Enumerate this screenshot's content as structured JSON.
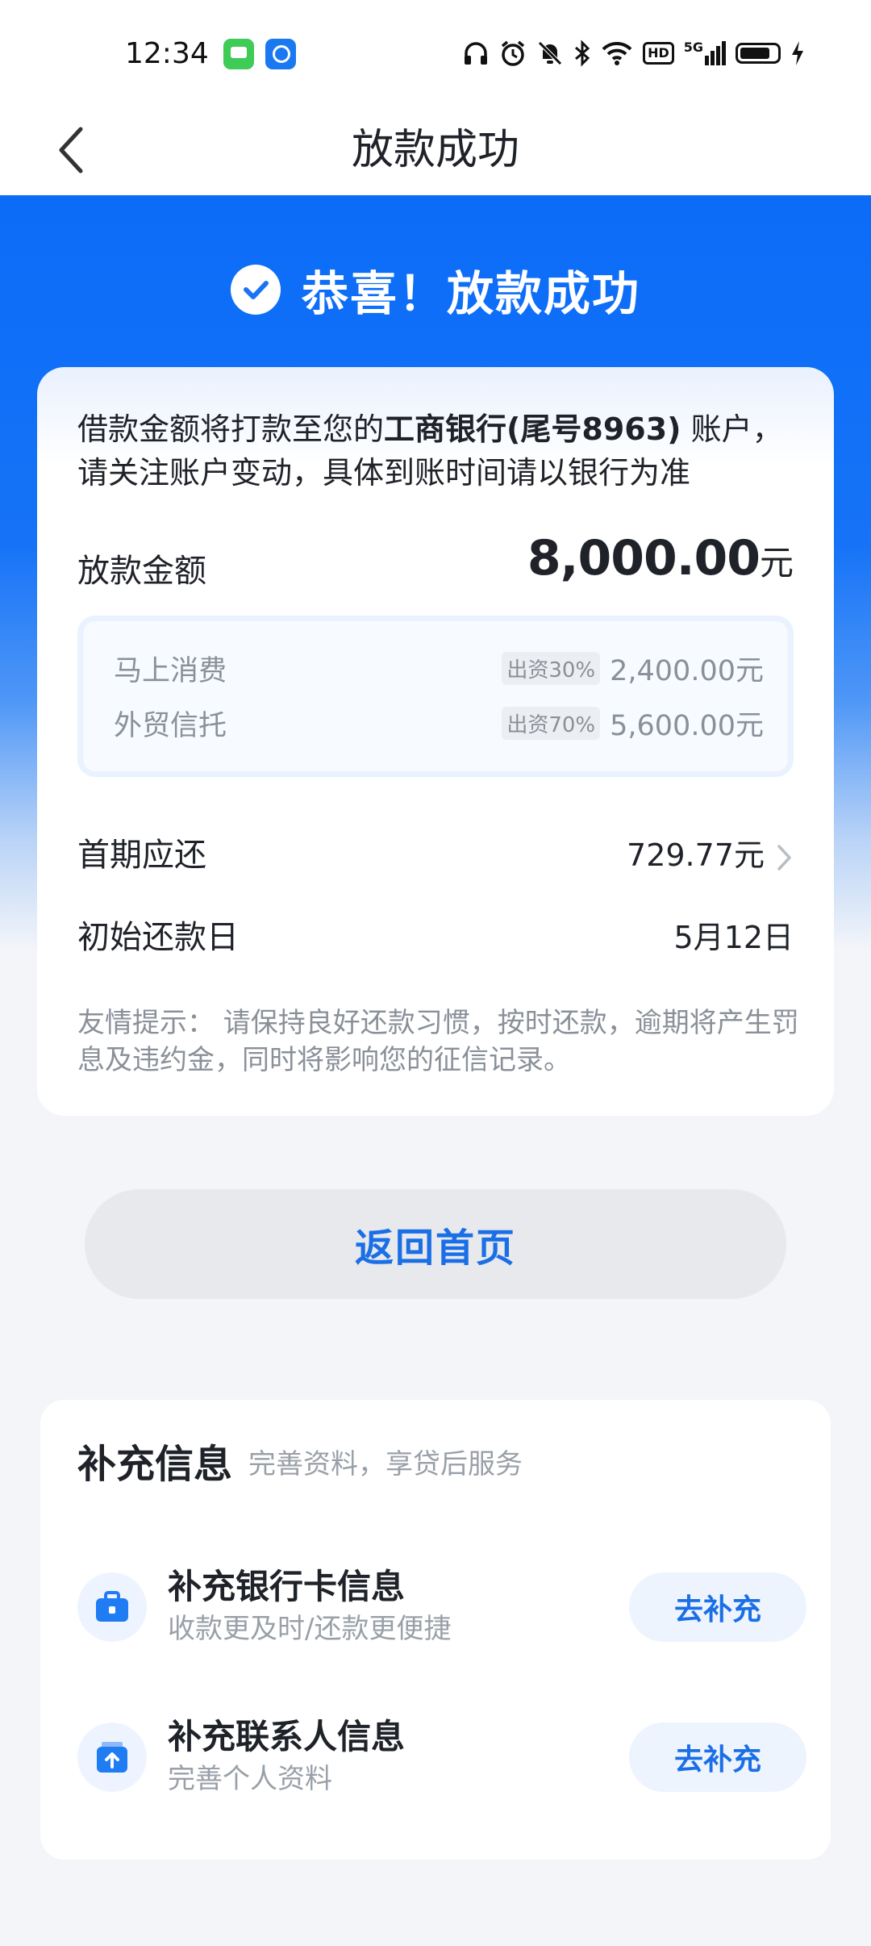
{
  "status_bar": {
    "time": "12:34",
    "apps": [
      "messages-app-icon",
      "browser-app-icon"
    ],
    "hd_label": "HD",
    "network_label": "5G"
  },
  "header": {
    "title": "放款成功",
    "back_icon": "chevron-left-icon"
  },
  "hero": {
    "success_text": "恭喜！放款成功",
    "icon": "check-circle-icon"
  },
  "loan_card": {
    "notice_prefix": "借款金额将打款至您的",
    "notice_bank": "工商银行(尾号8963)",
    "notice_suffix": " 账户，请关注账户变动，具体到账时间请以银行为准",
    "amount_label": "放款金额",
    "amount_value": "8,000.00",
    "amount_unit": "元",
    "funders": [
      {
        "name": "马上消费",
        "share": "出资30%",
        "amount": "2,400.00元"
      },
      {
        "name": "外贸信托",
        "share": "出资70%",
        "amount": "5,600.00元"
      }
    ],
    "first_payment_label": "首期应还",
    "first_payment_value": "729.77元",
    "first_date_label": "初始还款日",
    "first_date_value": "5月12日",
    "tip_label": "友情提示：",
    "tip_text": " 请保持良好还款习惯，按时还款，逾期将产生罚息及违约金，同时将影响您的征信记录。"
  },
  "home_button": {
    "label": "返回首页"
  },
  "supplement": {
    "title": "补充信息",
    "subtitle": "完善资料，享贷后服务",
    "items": [
      {
        "title": "补充银行卡信息",
        "desc": "收款更及时/还款更便捷",
        "button": "去补充",
        "icon": "briefcase-icon"
      },
      {
        "title": "补充联系人信息",
        "desc": "完善个人资料",
        "button": "去补充",
        "icon": "upload-box-icon"
      }
    ]
  },
  "colors": {
    "brand_blue": "#0b6cf8",
    "button_text_blue": "#1a6fe6"
  }
}
